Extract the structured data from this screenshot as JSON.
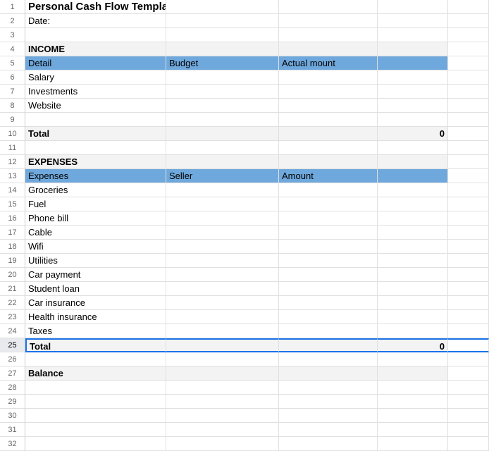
{
  "title": "Personal Cash Flow Template",
  "date_label": "Date:",
  "income": {
    "heading": "INCOME",
    "col1": "Detail",
    "col2": "Budget",
    "col3": "Actual mount",
    "items": [
      "Salary",
      "Investments",
      "Website"
    ],
    "total_label": "Total",
    "total_value": "0"
  },
  "expenses": {
    "heading": "EXPENSES",
    "col1": "Expenses",
    "col2": "Seller",
    "col3": "Amount",
    "items": [
      "Groceries",
      "Fuel",
      "Phone bill",
      "Cable",
      "Wifi",
      "Utilities",
      "Car payment",
      "Student loan",
      "Car insurance",
      "Health insurance",
      "Taxes"
    ],
    "total_label": "Total",
    "total_value": "0"
  },
  "balance_label": "Balance",
  "rownums": [
    "1",
    "2",
    "3",
    "4",
    "5",
    "6",
    "7",
    "8",
    "9",
    "10",
    "11",
    "12",
    "13",
    "14",
    "15",
    "16",
    "17",
    "18",
    "19",
    "20",
    "21",
    "22",
    "23",
    "24",
    "25",
    "26",
    "27",
    "28",
    "29",
    "30",
    "31",
    "32"
  ],
  "selected_row": 25
}
